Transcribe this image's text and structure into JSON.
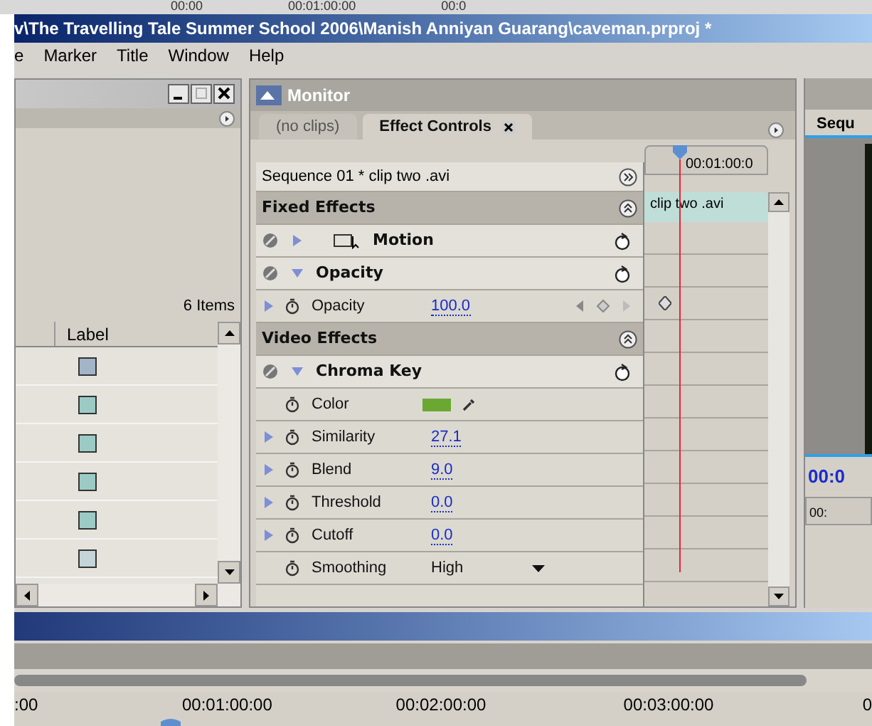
{
  "background_window": {
    "times": [
      "00:00",
      "00:01:00:00",
      "00:0"
    ]
  },
  "window": {
    "title": "v\\The Travelling Tale Summer School  2006\\Manish Anniyan Guarang\\caveman.prproj *"
  },
  "menu": [
    "e",
    "Marker",
    "Title",
    "Window",
    "Help"
  ],
  "project_panel": {
    "item_count": "6 Items",
    "columns": [
      "Label"
    ],
    "rows": [
      {
        "color": "#a3b4c8"
      },
      {
        "color": "#9ccbc6"
      },
      {
        "color": "#9ccbc6"
      },
      {
        "color": "#9ccbc6"
      },
      {
        "color": "#9ccbc6"
      },
      {
        "color": "#c4d4d8"
      }
    ]
  },
  "monitor": {
    "title": "Monitor",
    "tabs": [
      {
        "label": "(no clips)",
        "selected": false
      },
      {
        "label": "Effect Controls",
        "selected": true
      }
    ]
  },
  "effect_controls": {
    "clip": "Sequence 01 * clip two .avi",
    "timecode": "00:01:00:0",
    "clip_bar": "clip two .avi",
    "rows": [
      {
        "kind": "section",
        "label": "Fixed Effects"
      },
      {
        "kind": "effect",
        "label": "Motion",
        "expanded": false,
        "with_icon": true
      },
      {
        "kind": "effect",
        "label": "Opacity",
        "expanded": true,
        "with_icon": false
      },
      {
        "kind": "param",
        "label": "Opacity",
        "value": "100.0",
        "expandable": true,
        "keyframes": true
      },
      {
        "kind": "section",
        "label": "Video Effects"
      },
      {
        "kind": "effect",
        "label": "Chroma Key",
        "expanded": true,
        "with_icon": false
      },
      {
        "kind": "color",
        "label": "Color",
        "color": "#6aa832"
      },
      {
        "kind": "param",
        "label": "Similarity",
        "value": "27.1",
        "expandable": true,
        "keyframes": false
      },
      {
        "kind": "param",
        "label": "Blend",
        "value": "9.0",
        "expandable": true,
        "keyframes": false
      },
      {
        "kind": "param",
        "label": "Threshold",
        "value": "0.0",
        "expandable": true,
        "keyframes": false
      },
      {
        "kind": "param",
        "label": "Cutoff",
        "value": "0.0",
        "expandable": true,
        "keyframes": false
      },
      {
        "kind": "dropdown",
        "label": "Smoothing",
        "value": "High"
      }
    ]
  },
  "sequence_panel": {
    "tab": "Sequ",
    "timecode": "00:0",
    "ruler": "00:"
  },
  "timeline": {
    "ticks": [
      ":00",
      "00:01:00:00",
      "00:02:00:00",
      "00:03:00:00",
      "0"
    ]
  }
}
